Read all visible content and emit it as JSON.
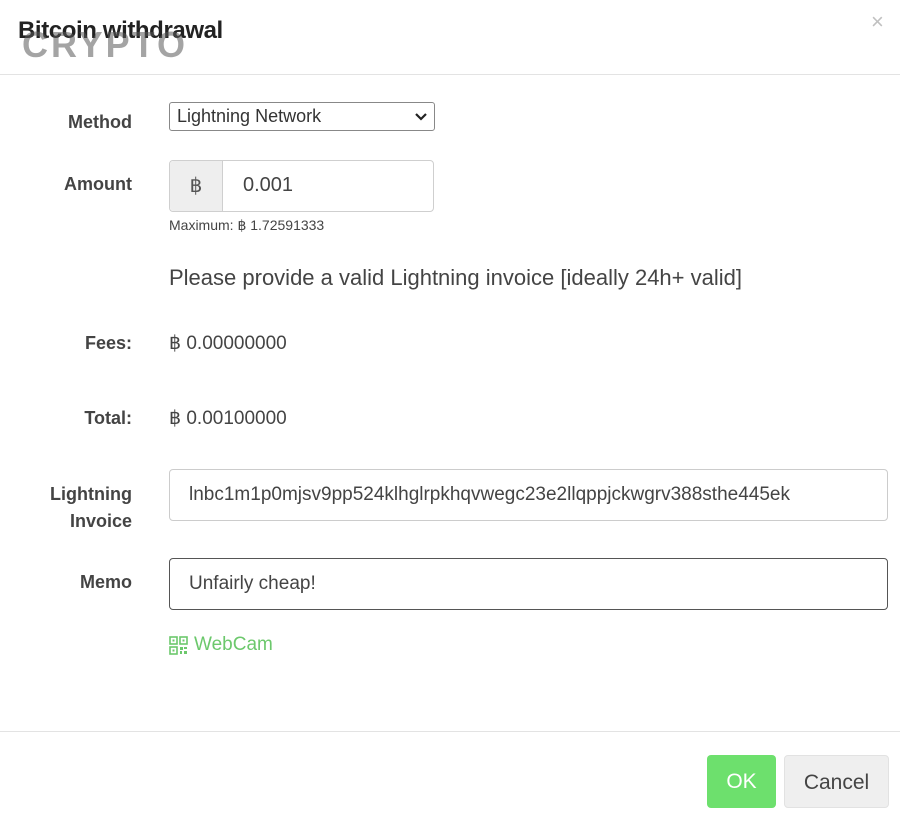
{
  "modal": {
    "title": "Bitcoin withdrawal",
    "watermark": "CRYPTO",
    "close_label": "×"
  },
  "form": {
    "method": {
      "label": "Method",
      "selected": "Lightning Network"
    },
    "amount": {
      "label": "Amount",
      "currency_symbol": "฿",
      "value": "0.001",
      "max_note": "Maximum: ฿ 1.72591333"
    },
    "info": "Please provide a valid Lightning invoice [ideally 24h+ valid]",
    "fees": {
      "label": "Fees:",
      "value": "฿ 0.00000000"
    },
    "total": {
      "label": "Total:",
      "value": "฿ 0.00100000"
    },
    "invoice": {
      "label_line1": "Lightning",
      "label_line2": "Invoice",
      "value": "lnbc1m1p0mjsv9pp524klhglrpkhqvwegc23e2llqppjckwgrv388sthe445ek"
    },
    "memo": {
      "label": "Memo",
      "value": "Unfairly cheap!"
    },
    "webcam_label": "WebCam"
  },
  "footer": {
    "ok_label": "OK",
    "cancel_label": "Cancel"
  },
  "colors": {
    "accent_green": "#6de06d",
    "link_green": "#6cc86c"
  }
}
